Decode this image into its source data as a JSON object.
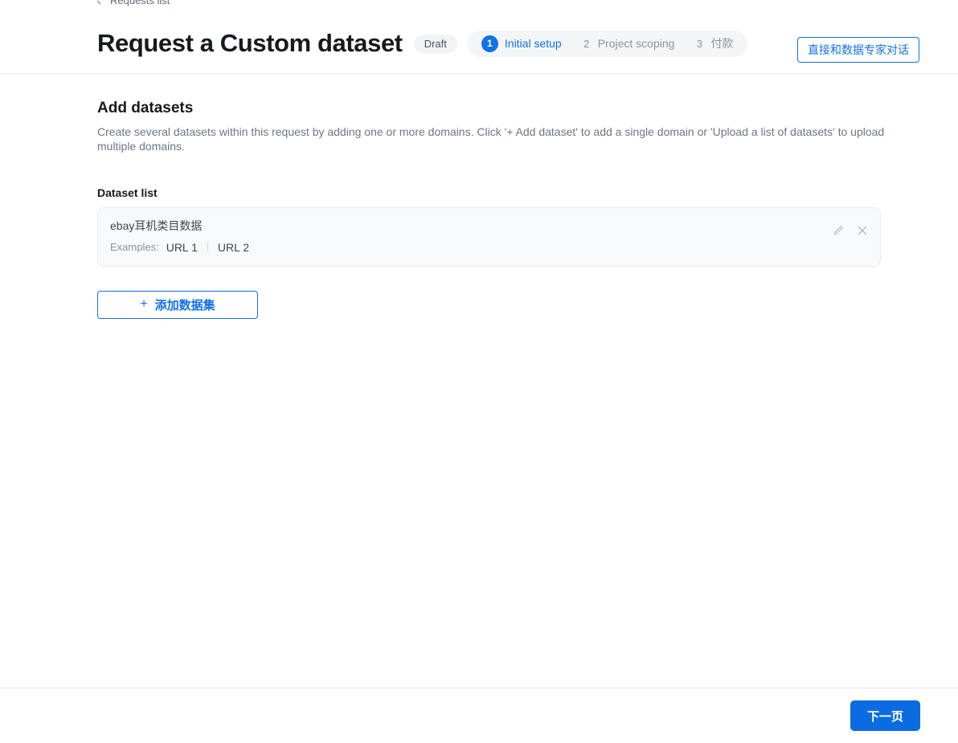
{
  "header": {
    "breadcrumb": "Requests list",
    "title": "Request a Custom dataset",
    "status_badge": "Draft",
    "steps": [
      {
        "num": "1",
        "label": "Initial setup",
        "active": true
      },
      {
        "num": "2",
        "label": "Project scoping",
        "active": false
      },
      {
        "num": "3",
        "label": "付款",
        "active": false
      }
    ],
    "expert_button": "直接和数据专家对话"
  },
  "main": {
    "section_title": "Add datasets",
    "section_description": "Create several datasets within this request by adding one or more domains. Click '+ Add dataset' to add a single domain or 'Upload a list of datasets' to upload multiple domains.",
    "list_label": "Dataset list",
    "datasets": [
      {
        "name": "ebay耳机类目数据",
        "examples_label": "Examples:",
        "example_links": [
          "URL 1",
          "URL 2"
        ],
        "edit_icon": "pencil-icon",
        "remove_icon": "close-icon"
      }
    ],
    "add_button": "添加数据集",
    "add_button_plus": "+"
  },
  "footer": {
    "next_button": "下一页"
  },
  "colors": {
    "accent": "#1271e8",
    "primary_button": "#0a6ce0",
    "muted_text": "#8b949e",
    "card_bg": "#f8f9fa"
  }
}
